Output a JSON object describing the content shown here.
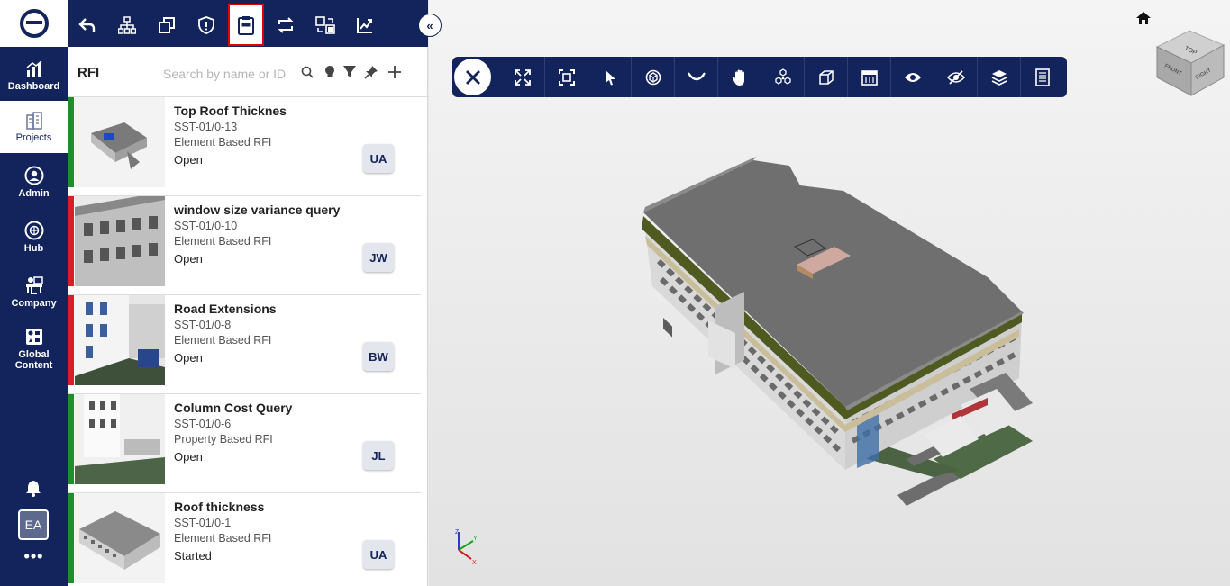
{
  "rail": {
    "items": [
      {
        "label": "Dashboard"
      },
      {
        "label": "Projects"
      },
      {
        "label": "Admin"
      },
      {
        "label": "Hub"
      },
      {
        "label": "Company"
      },
      {
        "label": "Global Content"
      }
    ],
    "avatar": "EA",
    "more": "•••"
  },
  "panel": {
    "title": "RFI",
    "search_placeholder": "Search by name or ID",
    "collapse": "«"
  },
  "rfis": [
    {
      "title": "Top Roof Thicknes",
      "id": "SST-01/0-13",
      "type": "Element Based RFI",
      "status": "Open",
      "assignee": "UA",
      "status_color": "#1e8f2a"
    },
    {
      "title": "window size variance query",
      "id": "SST-01/0-10",
      "type": "Element Based RFI",
      "status": "Open",
      "assignee": "JW",
      "status_color": "#d4202a"
    },
    {
      "title": "Road Extensions",
      "id": "SST-01/0-8",
      "type": "Element Based RFI",
      "status": "Open",
      "assignee": "BW",
      "status_color": "#d4202a"
    },
    {
      "title": "Column Cost Query",
      "id": "SST-01/0-6",
      "type": "Property Based RFI",
      "status": "Open",
      "assignee": "JL",
      "status_color": "#1e8f2a"
    },
    {
      "title": "Roof thickness",
      "id": "SST-01/0-1",
      "type": "Element Based RFI",
      "status": "Started",
      "assignee": "UA",
      "status_color": "#1e8f2a"
    }
  ],
  "viewer": {
    "navcube": {
      "top": "TOP",
      "front": "FRONT",
      "right": "RIGHT"
    },
    "axes": {
      "x": "X",
      "y": "Y",
      "z": "Z"
    }
  },
  "colors": {
    "navy": "#13235b",
    "active_border": "#e00000",
    "roof": "#6f6f6f"
  }
}
